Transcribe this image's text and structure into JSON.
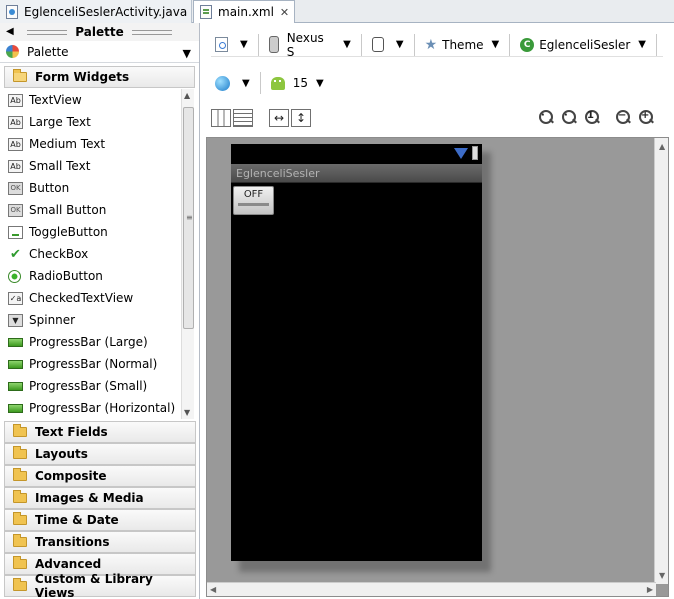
{
  "tabs": [
    {
      "label": "EglenceliSeslerActivity.java"
    },
    {
      "label": "main.xml",
      "close": "✕"
    }
  ],
  "palette": {
    "title": "Palette",
    "dropdown_label": "Palette",
    "section_open": "Form Widgets",
    "widgets": [
      {
        "label": "TextView",
        "icon": "text-icon",
        "glyph": "Ab"
      },
      {
        "label": "Large Text",
        "icon": "text-icon",
        "glyph": "Ab"
      },
      {
        "label": "Medium Text",
        "icon": "text-icon",
        "glyph": "Ab"
      },
      {
        "label": "Small Text",
        "icon": "text-icon",
        "glyph": "Ab"
      },
      {
        "label": "Button",
        "icon": "button-icon",
        "glyph": "OK"
      },
      {
        "label": "Small Button",
        "icon": "button-icon",
        "glyph": "OK"
      },
      {
        "label": "ToggleButton",
        "icon": "toggle-icon",
        "glyph": ""
      },
      {
        "label": "CheckBox",
        "icon": "checkbox-icon",
        "glyph": "✔"
      },
      {
        "label": "RadioButton",
        "icon": "radio-icon",
        "glyph": ""
      },
      {
        "label": "CheckedTextView",
        "icon": "checked-text-icon",
        "glyph": "✓a"
      },
      {
        "label": "Spinner",
        "icon": "spinner-icon",
        "glyph": "▼"
      },
      {
        "label": "ProgressBar (Large)",
        "icon": "progressbar-icon",
        "glyph": ""
      },
      {
        "label": "ProgressBar (Normal)",
        "icon": "progressbar-icon",
        "glyph": ""
      },
      {
        "label": "ProgressBar (Small)",
        "icon": "progressbar-icon",
        "glyph": ""
      },
      {
        "label": "ProgressBar (Horizontal)",
        "icon": "progressbar-icon",
        "glyph": ""
      }
    ],
    "categories": [
      "Text Fields",
      "Layouts",
      "Composite",
      "Images & Media",
      "Time & Date",
      "Transitions",
      "Advanced",
      "Custom & Library Views"
    ]
  },
  "toolbar": {
    "device": "Nexus S",
    "theme": "Theme",
    "activity": "EglenceliSesler",
    "api_level": "15"
  },
  "device_preview": {
    "app_title": "EglenceliSesler",
    "toggle_text": "OFF"
  },
  "colors": {
    "canvas_bg": "#999999",
    "device_bg": "#000000",
    "status_icon": "#3d6cc7",
    "android_green": "#8dc63f"
  }
}
